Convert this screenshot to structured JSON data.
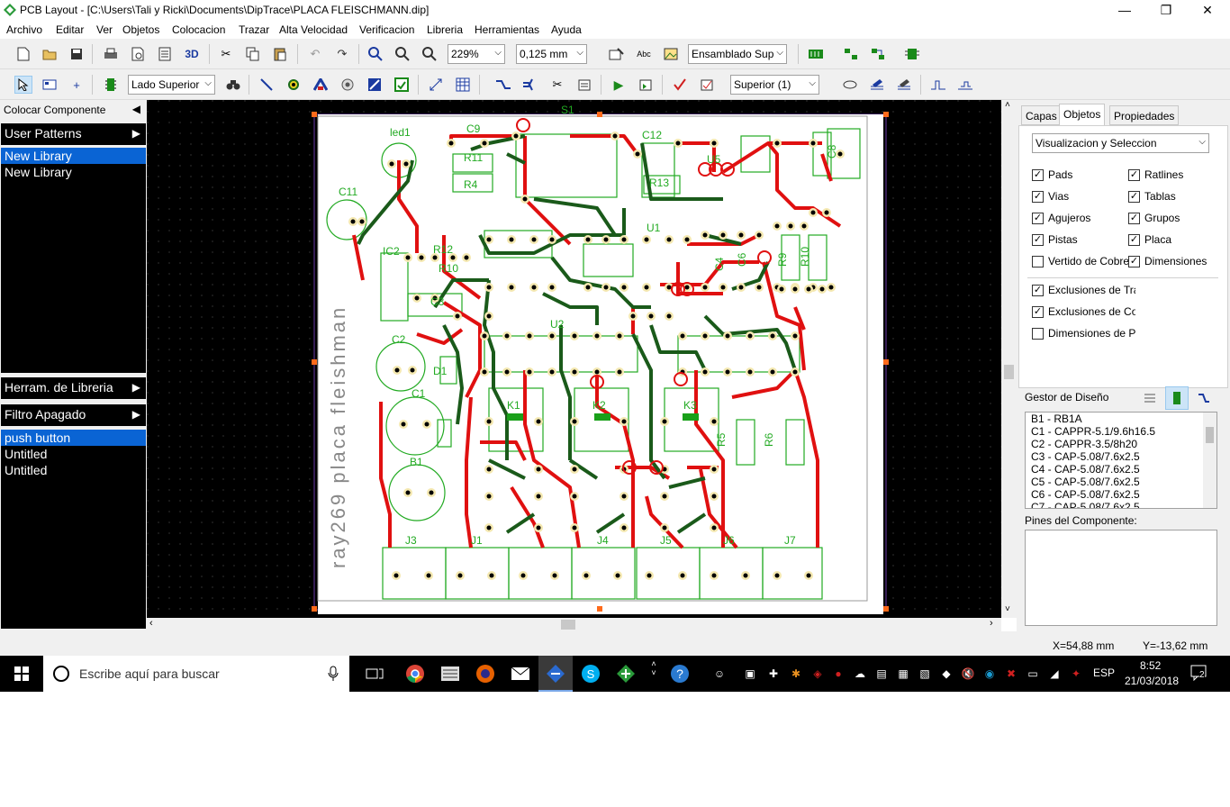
{
  "window": {
    "title": "PCB Layout - [C:\\Users\\Tali y Ricki\\Documents\\DipTrace\\PLACA FLEISCHMANN.dip]",
    "minimize": "—",
    "restore": "❐",
    "close": "✕"
  },
  "menu": [
    "Archivo",
    "Editar",
    "Ver",
    "Objetos",
    "Colocacion",
    "Trazar",
    "Alta Velocidad",
    "Verificacion",
    "Libreria",
    "Herramientas",
    "Ayuda"
  ],
  "toolbar1": {
    "threed_label": "3D",
    "abc_label": "Abc",
    "zoom_value": "229%",
    "grid_value": "0,125 mm",
    "assembly_value": "Ensamblado Sup"
  },
  "toolbar2": {
    "side_value": "Lado Superior",
    "layer_value": "Superior (1)"
  },
  "left_panel": {
    "header": "Colocar Componente",
    "user_patterns": "User Patterns",
    "libraries": [
      "New Library",
      "New Library"
    ],
    "lib_tools": "Herram. de Libreria",
    "filter": "Filtro Apagado",
    "patterns": [
      "push button",
      "Untitled",
      "Untitled"
    ]
  },
  "canvas": {
    "component_labels": [
      "S1",
      "led1",
      "C9",
      "C12",
      "R11",
      "R4",
      "R13",
      "U5",
      "C11",
      "IC2",
      "R12",
      "R10",
      "U1",
      "C3",
      "C2",
      "D1",
      "C1",
      "B1",
      "U2",
      "K1",
      "K2",
      "K3",
      "R5",
      "R6",
      "R9",
      "R10",
      "J3",
      "J1",
      "J4",
      "J5",
      "J6",
      "J7",
      "C6",
      "C8",
      "C4"
    ],
    "silkscreen_text": "ray269   placa   fleishman"
  },
  "right_panel": {
    "tabs": [
      "Capas",
      "Objetos",
      "Propiedades"
    ],
    "active_tab": "Objetos",
    "view_mode": "Visualizacion y Seleccion",
    "checks_left": [
      {
        "label": "Pads",
        "checked": true
      },
      {
        "label": "Vias",
        "checked": true
      },
      {
        "label": "Agujeros",
        "checked": true
      },
      {
        "label": "Pistas",
        "checked": true
      },
      {
        "label": "Vertido de Cobre",
        "checked": false
      }
    ],
    "checks_right": [
      {
        "label": "Ratlines",
        "checked": true
      },
      {
        "label": "Tablas",
        "checked": true
      },
      {
        "label": "Grupos",
        "checked": true
      },
      {
        "label": "Placa",
        "checked": true
      },
      {
        "label": "Dimensiones",
        "checked": true
      }
    ],
    "checks_bottom": [
      {
        "label": "Exclusiones de Trazado",
        "checked": true
      },
      {
        "label": "Exclusiones de Colocacion",
        "checked": true
      },
      {
        "label": "Dimensiones de Patron",
        "checked": false
      }
    ],
    "design_manager": "Gestor de Diseño",
    "components": [
      "B1 - RB1A",
      "C1 - CAPPR-5.1/9.6h16.5",
      "C2 - CAPPR-3.5/8h20",
      "C3 - CAP-5.08/7.6x2.5",
      "C4 - CAP-5.08/7.6x2.5",
      "C5 - CAP-5.08/7.6x2.5",
      "C6 - CAP-5.08/7.6x2.5",
      "C7 - CAP-5.08/7.6x2.5"
    ],
    "pins_label": "Pines del Componente:"
  },
  "status": {
    "x": "X=54,88 mm",
    "y": "Y=-13,62 mm"
  },
  "taskbar": {
    "search_placeholder": "Escribe aquí para buscar",
    "lang": "ESP",
    "time": "8:52",
    "date": "21/03/2018",
    "notif_count": "2"
  },
  "colors": {
    "canvas": "#000000",
    "board": "#ffffff",
    "top_trace": "#e01010",
    "bottom_trace": "#1a5a1a",
    "silk": "#22aa22",
    "selection": "#0a64d4"
  }
}
